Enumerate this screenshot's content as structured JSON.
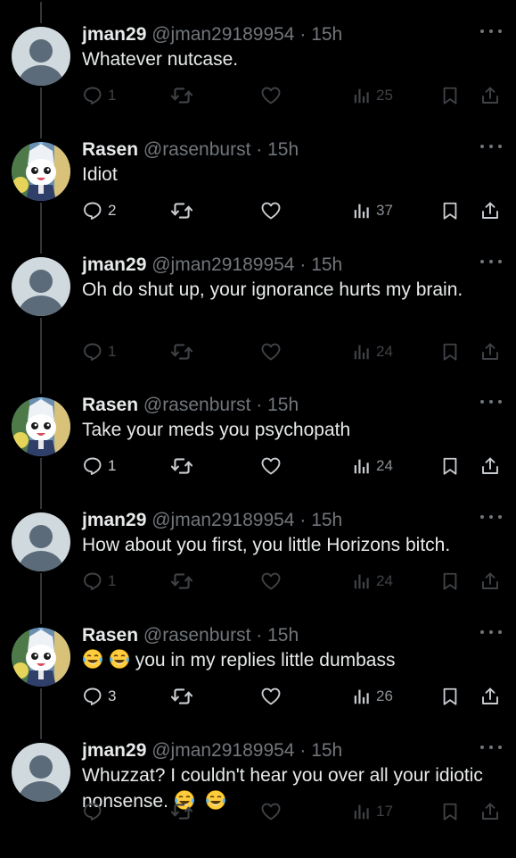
{
  "colors": {
    "background": "#000000",
    "text": "#e7e9ea",
    "secondary_text": "#71767b",
    "thread_line": "#333639",
    "dim_icon": "#3f4347",
    "bright_icon": "#c9cdd1"
  },
  "tweets": [
    {
      "avatar": "default-gray-avatar",
      "display_name": "jman29",
      "handle": "@jman29189954",
      "dot": "·",
      "time": "15h",
      "text": "Whatever nutcase.",
      "emoji_prefix": "",
      "emoji_suffix": "",
      "replies": "1",
      "views": "25",
      "icon_state": "dim"
    },
    {
      "avatar": "anime-character-avatar",
      "display_name": "Rasen",
      "handle": "@rasenburst",
      "dot": "·",
      "time": "15h",
      "text": "Idiot",
      "emoji_prefix": "",
      "emoji_suffix": "",
      "replies": "2",
      "views": "37",
      "icon_state": "bright"
    },
    {
      "avatar": "default-gray-avatar",
      "display_name": "jman29",
      "handle": "@jman29189954",
      "dot": "·",
      "time": "15h",
      "text": "Oh do shut up, your ignorance hurts my brain.",
      "emoji_prefix": "",
      "emoji_suffix": "",
      "replies": "1",
      "views": "24",
      "icon_state": "dim"
    },
    {
      "avatar": "anime-character-avatar",
      "display_name": "Rasen",
      "handle": "@rasenburst",
      "dot": "·",
      "time": "15h",
      "text": "Take your meds you psychopath",
      "emoji_prefix": "",
      "emoji_suffix": "",
      "replies": "1",
      "views": "24",
      "icon_state": "bright"
    },
    {
      "avatar": "default-gray-avatar",
      "display_name": "jman29",
      "handle": "@jman29189954",
      "dot": "·",
      "time": "15h",
      "text": "How about you first, you little Horizons bitch.",
      "emoji_prefix": "",
      "emoji_suffix": "",
      "replies": "1",
      "views": "24",
      "icon_state": "dim"
    },
    {
      "avatar": "anime-character-avatar",
      "display_name": "Rasen",
      "handle": "@rasenburst",
      "dot": "·",
      "time": "15h",
      "text": "you in my replies little dumbass",
      "emoji_prefix": "😂😂",
      "emoji_suffix": "",
      "replies": "3",
      "views": "26",
      "icon_state": "bright"
    },
    {
      "avatar": "default-gray-avatar",
      "display_name": "jman29",
      "handle": "@jman29189954",
      "dot": "·",
      "time": "15h",
      "text": "Whuzzat? I couldn't hear you over all your idiotic nonsense.",
      "emoji_prefix": "",
      "emoji_suffix": "😂 😂",
      "replies": "",
      "views": "17",
      "icon_state": "dim"
    }
  ]
}
